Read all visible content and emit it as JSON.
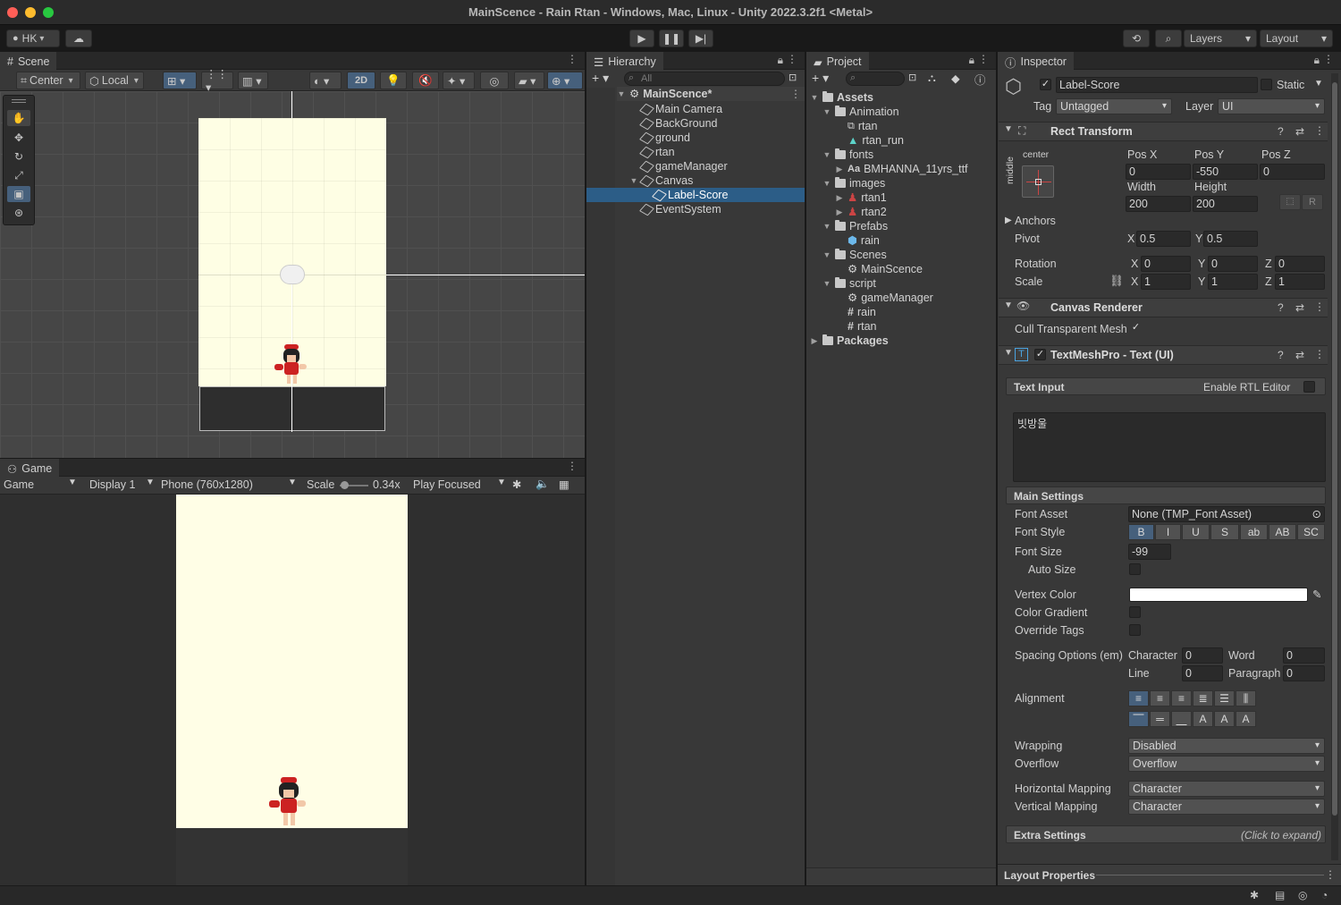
{
  "window": {
    "title": "MainScence - Rain Rtan - Windows, Mac, Linux - Unity 2022.3.2f1 <Metal>"
  },
  "toolbar": {
    "account": "HK",
    "layers": "Layers",
    "layout": "Layout"
  },
  "scene": {
    "tab": "Scene",
    "pivot": "Center",
    "space": "Local",
    "mode_2d": "2D"
  },
  "game": {
    "tab": "Game",
    "view": "Game",
    "display": "Display 1",
    "resolution": "Phone (760x1280)",
    "scale_label": "Scale",
    "scale_value": "0.34x",
    "play_mode": "Play Focused"
  },
  "hierarchy": {
    "tab": "Hierarchy",
    "search_placeholder": "All",
    "scene_name": "MainScence*",
    "items": [
      "Main Camera",
      "BackGround",
      "ground",
      "rtan",
      "gameManager",
      "Canvas",
      "Label-Score",
      "EventSystem"
    ]
  },
  "project": {
    "tab": "Project",
    "tree": {
      "assets": "Assets",
      "animation": "Animation",
      "anim_rtan": "rtan",
      "anim_rtan_run": "rtan_run",
      "fonts": "fonts",
      "font_file": "BMHANNA_11yrs_ttf",
      "font_prefix": "Aa",
      "images": "images",
      "img_rtan1": "rtan1",
      "img_rtan2": "rtan2",
      "prefabs": "Prefabs",
      "prefab_rain": "rain",
      "scenes": "Scenes",
      "scene_main": "MainScence",
      "script": "script",
      "script_gm": "gameManager",
      "script_rain": "rain",
      "script_rtan": "rtan",
      "packages": "Packages"
    }
  },
  "inspector": {
    "tab": "Inspector",
    "object_name": "Label-Score",
    "static_label": "Static",
    "tag_label": "Tag",
    "tag_value": "Untagged",
    "layer_label": "Layer",
    "layer_value": "UI",
    "rect": {
      "title": "Rect Transform",
      "anchor_h": "center",
      "anchor_v": "middle",
      "posx_label": "Pos X",
      "posx": "0",
      "posy_label": "Pos Y",
      "posy": "-550",
      "posz_label": "Pos Z",
      "posz": "0",
      "width_label": "Width",
      "width": "200",
      "height_label": "Height",
      "height": "200",
      "r_btn": "R",
      "anchors_label": "Anchors",
      "pivot_label": "Pivot",
      "pivot_x": "0.5",
      "pivot_y": "0.5",
      "rotation_label": "Rotation",
      "rot_x": "0",
      "rot_y": "0",
      "rot_z": "0",
      "scale_label": "Scale",
      "scale_x": "1",
      "scale_y": "1",
      "scale_z": "1",
      "x": "X",
      "y": "Y",
      "z": "Z"
    },
    "canvas_renderer": {
      "title": "Canvas Renderer",
      "cull_label": "Cull Transparent Mesh"
    },
    "tmp": {
      "title": "TextMeshPro - Text (UI)",
      "text_input_label": "Text Input",
      "rtl_label": "Enable RTL Editor",
      "text_value": "빗방울",
      "main_settings": "Main Settings",
      "font_asset_label": "Font Asset",
      "font_asset_value": "None (TMP_Font Asset)",
      "font_style_label": "Font Style",
      "font_styles": [
        "B",
        "I",
        "U",
        "S",
        "ab",
        "AB",
        "SC"
      ],
      "font_size_label": "Font Size",
      "font_size_value": "-99",
      "auto_size_label": "Auto Size",
      "vertex_color_label": "Vertex Color",
      "vertex_color": "#ffffff",
      "color_gradient_label": "Color Gradient",
      "override_tags_label": "Override Tags",
      "spacing_label": "Spacing Options (em)",
      "character_label": "Character",
      "character_value": "0",
      "word_label": "Word",
      "word_value": "0",
      "line_label": "Line",
      "line_value": "0",
      "paragraph_label": "Paragraph",
      "paragraph_value": "0",
      "alignment_label": "Alignment",
      "wrapping_label": "Wrapping",
      "wrapping_value": "Disabled",
      "overflow_label": "Overflow",
      "overflow_value": "Overflow",
      "hmap_label": "Horizontal Mapping",
      "hmap_value": "Character",
      "vmap_label": "Vertical Mapping",
      "vmap_value": "Character",
      "extra_settings": "Extra Settings",
      "click_expand": "(Click to expand)"
    },
    "layout_properties": "Layout Properties"
  },
  "colors": {
    "selection": "#2c5d87",
    "game_bg": "#fffee6",
    "accent_blue": "#46607c"
  }
}
